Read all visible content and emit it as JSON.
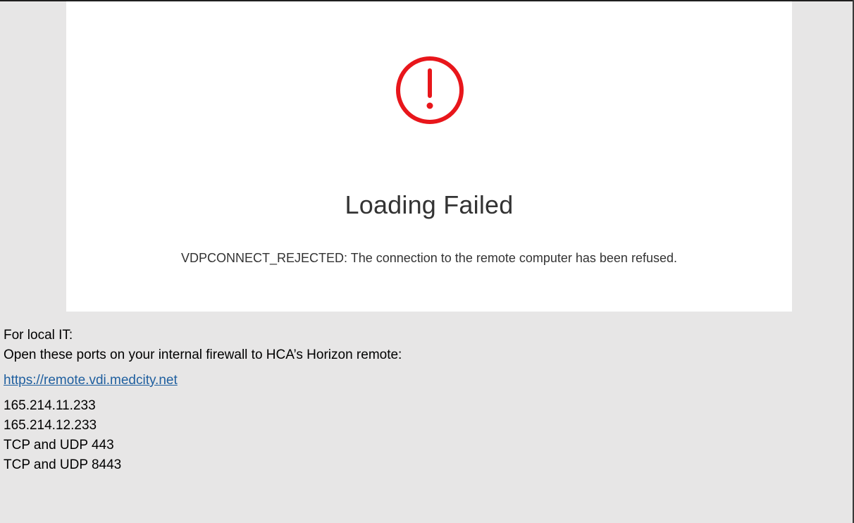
{
  "dialog": {
    "title": "Loading Failed",
    "message": "VDPCONNECT_REJECTED: The connection to the remote computer has been refused.",
    "icon": "exclamation-circle-icon",
    "icon_color": "#e8161b"
  },
  "notes": {
    "heading": "For local IT:",
    "instruction": "Open these ports on your internal firewall to HCA’s Horizon remote:",
    "link_text": "https://remote.vdi.medcity.net",
    "entries": [
      "165.214.11.233",
      "165.214.12.233",
      "TCP and UDP 443",
      "TCP and UDP 8443"
    ]
  },
  "colors": {
    "background": "#e7e6e6",
    "panel": "#ffffff",
    "link": "#1f5f9f"
  }
}
